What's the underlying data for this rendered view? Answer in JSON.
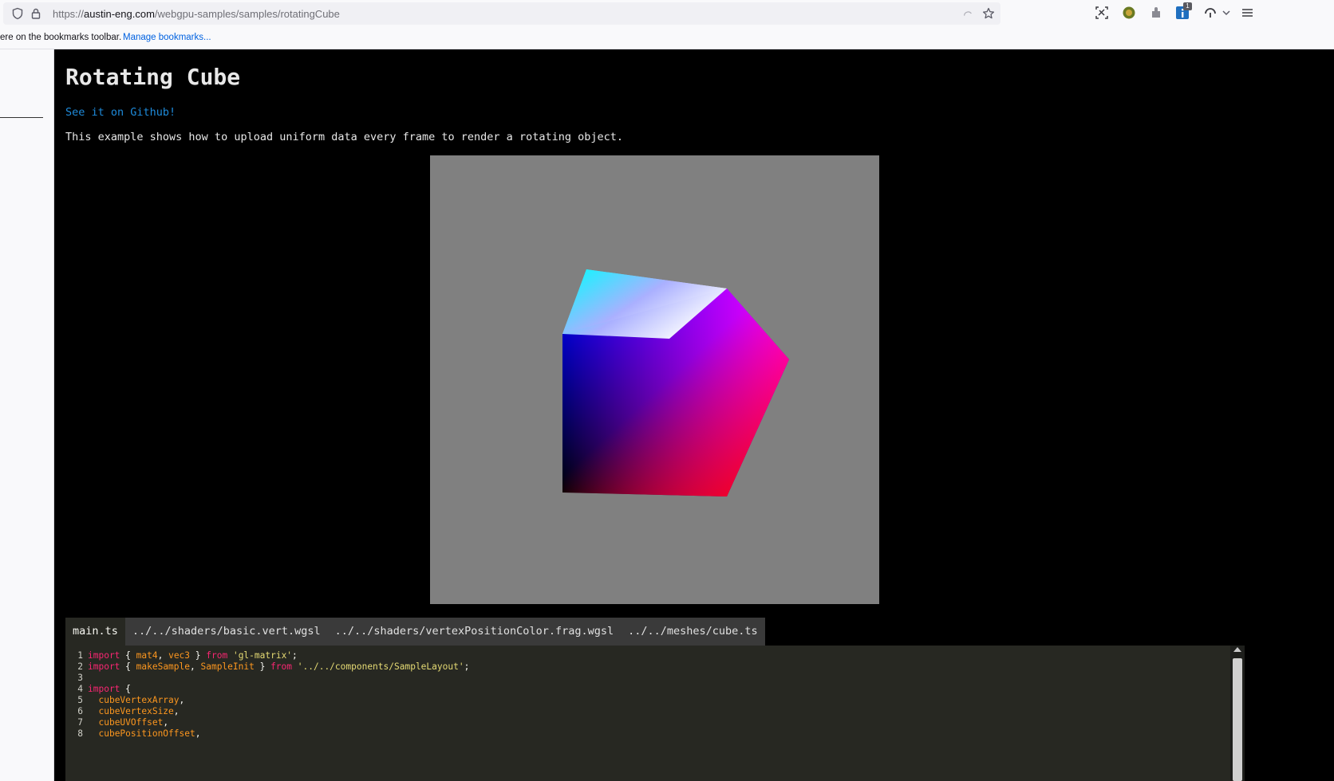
{
  "browser": {
    "url_prefix": "https://",
    "url_host": "austin-eng.com",
    "url_path": "/webgpu-samples/samples/rotatingCube",
    "bookmarks_text": "ere on the bookmarks toolbar.",
    "bookmarks_link": "Manage bookmarks...",
    "extension_badge": "1",
    "icons": [
      "shield-icon",
      "lock-icon",
      "reader-icon",
      "star-icon",
      "screenshot-icon",
      "avatar-icon",
      "extension-icon",
      "info-extension-icon",
      "sync-icon",
      "chevron-down-icon",
      "menu-icon"
    ]
  },
  "page": {
    "title": "Rotating Cube",
    "github_link": "See it on Github!",
    "description": "This example shows how to upload uniform data every frame to render a rotating object."
  },
  "tabs": [
    {
      "label": "main.ts",
      "active": true
    },
    {
      "label": "../../shaders/basic.vert.wgsl",
      "active": false
    },
    {
      "label": "../../shaders/vertexPositionColor.frag.wgsl",
      "active": false
    },
    {
      "label": "../../meshes/cube.ts",
      "active": false
    }
  ],
  "code": {
    "lines": [
      {
        "n": "1",
        "t": [
          [
            "kw",
            "import"
          ],
          [
            "p",
            " { "
          ],
          [
            "id",
            "mat4"
          ],
          [
            "p",
            ", "
          ],
          [
            "id",
            "vec3"
          ],
          [
            "p",
            " } "
          ],
          [
            "kw",
            "from"
          ],
          [
            "p",
            " "
          ],
          [
            "str",
            "'gl-matrix'"
          ],
          [
            "p",
            ";"
          ]
        ]
      },
      {
        "n": "2",
        "t": [
          [
            "kw",
            "import"
          ],
          [
            "p",
            " { "
          ],
          [
            "id",
            "makeSample"
          ],
          [
            "p",
            ", "
          ],
          [
            "id",
            "SampleInit"
          ],
          [
            "p",
            " } "
          ],
          [
            "kw",
            "from"
          ],
          [
            "p",
            " "
          ],
          [
            "str",
            "'../../components/SampleLayout'"
          ],
          [
            "p",
            ";"
          ]
        ]
      },
      {
        "n": "3",
        "t": []
      },
      {
        "n": "4",
        "t": [
          [
            "kw",
            "import"
          ],
          [
            "p",
            " {"
          ]
        ]
      },
      {
        "n": "5",
        "t": [
          [
            "p",
            "  "
          ],
          [
            "id",
            "cubeVertexArray"
          ],
          [
            "p",
            ","
          ]
        ]
      },
      {
        "n": "6",
        "t": [
          [
            "p",
            "  "
          ],
          [
            "id",
            "cubeVertexSize"
          ],
          [
            "p",
            ","
          ]
        ]
      },
      {
        "n": "7",
        "t": [
          [
            "p",
            "  "
          ],
          [
            "id",
            "cubeUVOffset"
          ],
          [
            "p",
            ","
          ]
        ]
      },
      {
        "n": "8",
        "t": [
          [
            "p",
            "  "
          ],
          [
            "id",
            "cubePositionOffset"
          ],
          [
            "p",
            ","
          ]
        ]
      }
    ]
  },
  "colors": {
    "page_bg": "#000000",
    "canvas_bg": "#808080",
    "link": "#1e8bdb",
    "editor_bg": "#272822",
    "keyword": "#f92672",
    "identifier": "#fd971f",
    "string": "#e6db74"
  }
}
